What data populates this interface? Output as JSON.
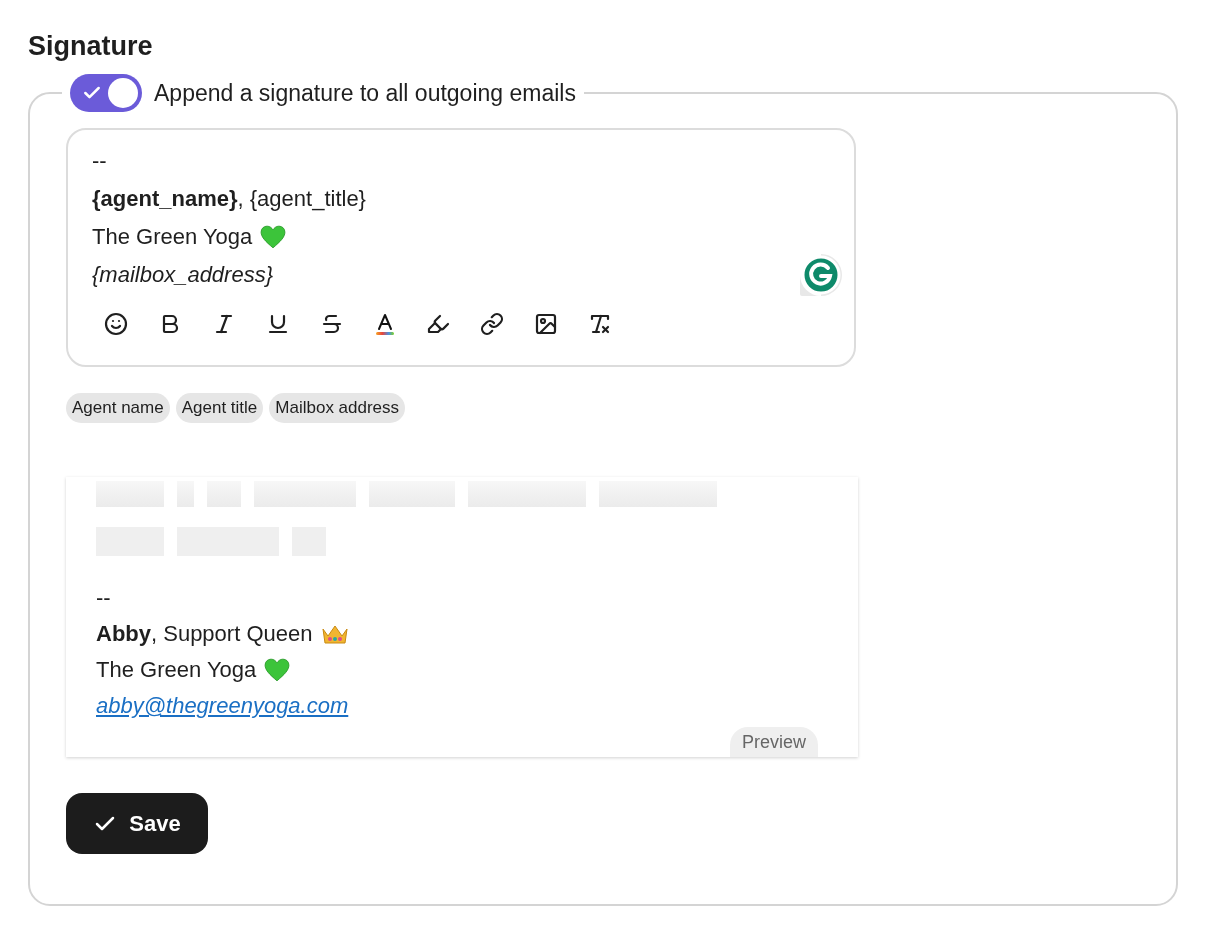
{
  "heading": "Signature",
  "toggle": {
    "label": "Append a signature to all outgoing emails",
    "on": true
  },
  "editor": {
    "lines": [
      {
        "text": "--",
        "kind": "plain"
      },
      {
        "text": "**{agent_name}**, {agent_title}",
        "kind": "plain"
      },
      {
        "text": "The Green Yoga",
        "kind": "heart"
      },
      {
        "text": "{mailbox_address}",
        "kind": "italic"
      }
    ]
  },
  "chips": [
    "Agent name",
    "Agent title",
    "Mailbox address"
  ],
  "preview": {
    "label": "Preview",
    "lines": [
      {
        "text": "--",
        "kind": "plain"
      },
      {
        "text": "**Abby**, Support Queen",
        "kind": "crown"
      },
      {
        "text": "The Green Yoga",
        "kind": "heart"
      },
      {
        "text": "abby@thegreenyoga.com",
        "kind": "link"
      }
    ]
  },
  "save_button": "Save"
}
